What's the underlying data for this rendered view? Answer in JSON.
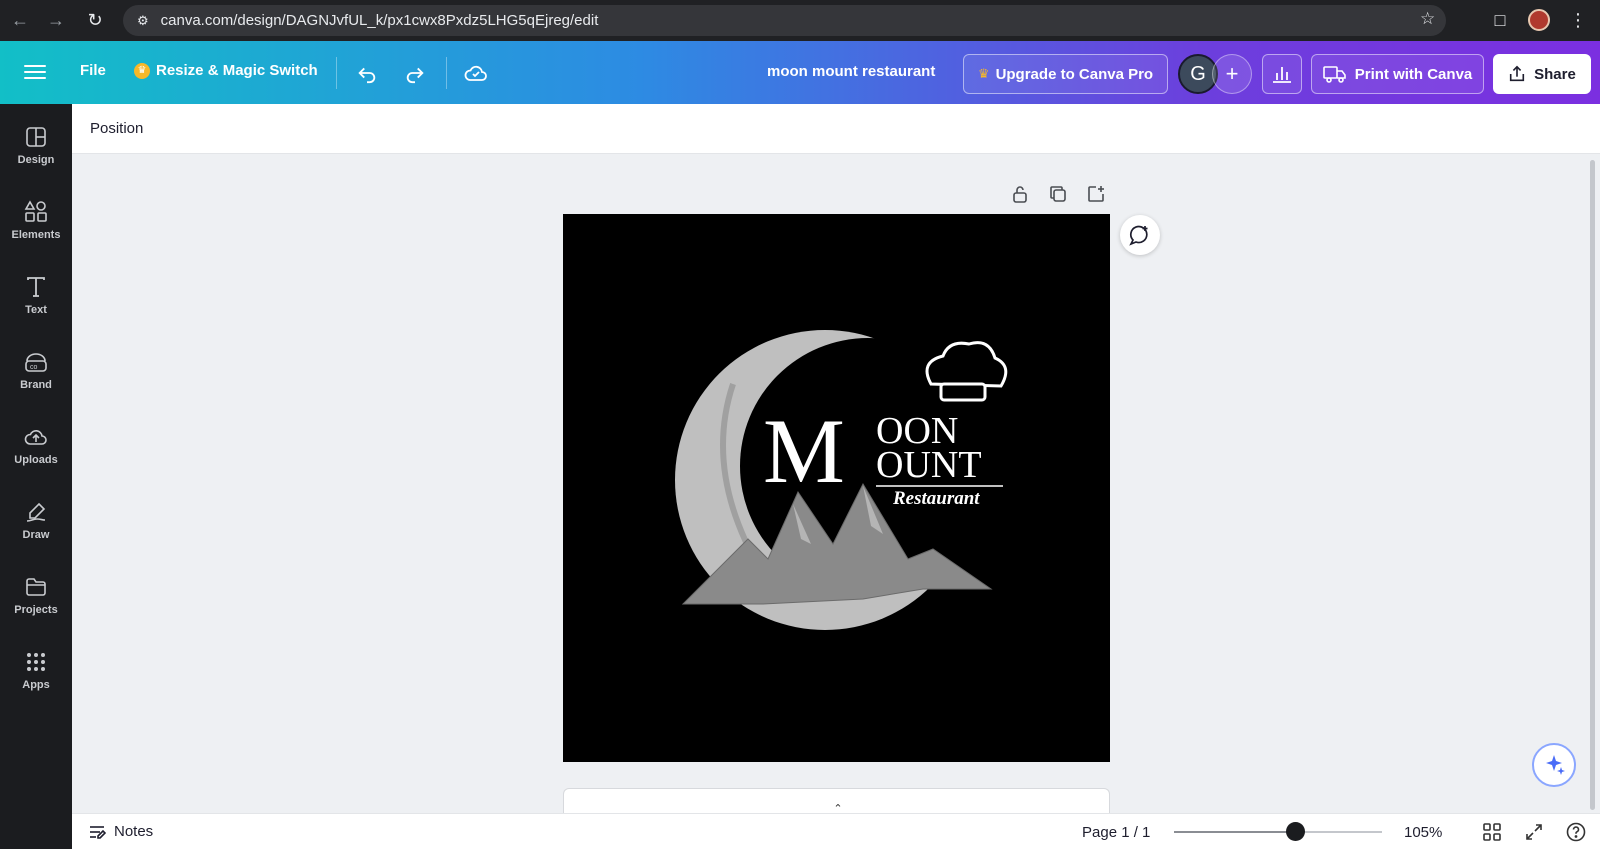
{
  "browser": {
    "url": "canva.com/design/DAGNJvfUL_k/px1cwx8Pxdz5LHG5qEjreg/edit"
  },
  "toolbar": {
    "file_label": "File",
    "resize_label": "Resize & Magic Switch",
    "doc_title": "moon mount restaurant",
    "upgrade_label": "Upgrade to Canva Pro",
    "avatar_initial": "G",
    "print_label": "Print with Canva",
    "share_label": "Share"
  },
  "sidebar": {
    "items": [
      {
        "label": "Design",
        "icon": "design-icon"
      },
      {
        "label": "Elements",
        "icon": "elements-icon"
      },
      {
        "label": "Text",
        "icon": "text-icon"
      },
      {
        "label": "Brand",
        "icon": "brand-icon"
      },
      {
        "label": "Uploads",
        "icon": "uploads-icon"
      },
      {
        "label": "Draw",
        "icon": "draw-icon"
      },
      {
        "label": "Projects",
        "icon": "projects-icon"
      },
      {
        "label": "Apps",
        "icon": "apps-icon"
      }
    ]
  },
  "context": {
    "position_label": "Position"
  },
  "design": {
    "logo_initial_1": "M",
    "logo_line_1": "OON",
    "logo_line_2": "OUNT",
    "logo_sub": "Restaurant"
  },
  "footer": {
    "notes_label": "Notes",
    "page_indicator": "Page 1 / 1",
    "zoom": "105%",
    "zoom_fraction": 0.58
  },
  "colors": {
    "sidebar_bg": "#1b1c1f",
    "gradient_start": "#12bfc7",
    "gradient_end": "#7b2fe0",
    "canvas_bg": "#000000"
  }
}
